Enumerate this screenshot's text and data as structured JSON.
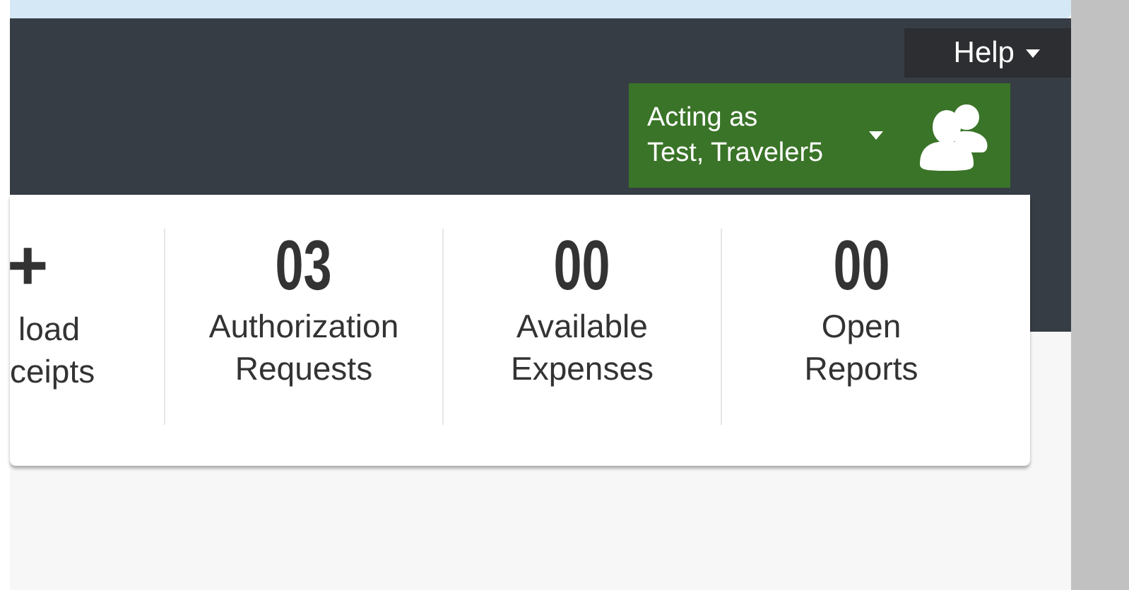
{
  "help_menu": {
    "label": "Help"
  },
  "acting_as": {
    "label": "Acting as",
    "user": "Test, Traveler5"
  },
  "tiles": [
    {
      "kind": "action",
      "icon": "+",
      "lines": [
        "load",
        "ceipts"
      ]
    },
    {
      "kind": "count",
      "count": "03",
      "lines": [
        "Authorization",
        "Requests"
      ]
    },
    {
      "kind": "count",
      "count": "00",
      "lines": [
        "Available",
        "Expenses"
      ]
    },
    {
      "kind": "count",
      "count": "00",
      "lines": [
        "Open",
        "Reports"
      ]
    }
  ]
}
